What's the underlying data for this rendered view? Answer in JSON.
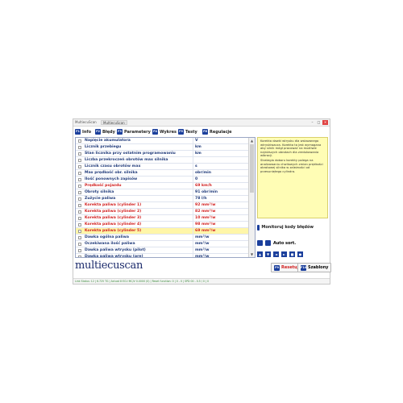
{
  "window": {
    "title": "MultiecuScan",
    "tab_label": "MultiecuScan",
    "min_glyph": "–",
    "max_glyph": "□",
    "close_glyph": "✕"
  },
  "tabs": [
    {
      "key": "F1",
      "label": "Info"
    },
    {
      "key": "F2",
      "label": "Błędy"
    },
    {
      "key": "F3",
      "label": "Parametery"
    },
    {
      "key": "F4",
      "label": "Wykres"
    },
    {
      "key": "F5",
      "label": "Testy"
    },
    {
      "key": "F6",
      "label": "Regulacje"
    }
  ],
  "params": [
    {
      "name": "Napięcie akumulatora",
      "value": "V",
      "style": "blue"
    },
    {
      "name": "Licznik przebiegu",
      "value": "km",
      "style": "blue"
    },
    {
      "name": "Stan licznika przy ostatnim programowaniu",
      "value": "km",
      "style": "blue"
    },
    {
      "name": "Liczba przekroczeń obrotów max silnika",
      "value": "",
      "style": "blue"
    },
    {
      "name": "Licznik czasu obrotów max",
      "value": "s",
      "style": "blue"
    },
    {
      "name": "Max prędkość obr. silnika",
      "value": "obr/min",
      "style": "blue"
    },
    {
      "name": "Ilość ponownych zapisów",
      "value": "0",
      "style": "blue"
    },
    {
      "name": "Prędkość pojazdu",
      "value": "69 km/h",
      "style": "red"
    },
    {
      "name": "Obroty silnika",
      "value": "91 obr/min",
      "style": "blue"
    },
    {
      "name": "Zużycie paliwa",
      "value": "78 l/h",
      "style": "blue"
    },
    {
      "name": "Korekta paliwa (cylinder 1)",
      "value": "92 mm³/w",
      "style": "red"
    },
    {
      "name": "Korekta paliwa (cylinder 2)",
      "value": "82 mm³/w",
      "style": "red"
    },
    {
      "name": "Korekta paliwa (cylinder 3)",
      "value": "10 mm³/w",
      "style": "red"
    },
    {
      "name": "Korekta paliwa (cylinder 4)",
      "value": "98 mm³/w",
      "style": "red"
    },
    {
      "name": "Korekta paliwa (cylinder 5)",
      "value": "69 mm³/w",
      "style": "red hl"
    },
    {
      "name": "Dawka ogólna paliwa",
      "value": "mm³/w",
      "style": "blue"
    },
    {
      "name": "Oczekiwana ilość paliwa",
      "value": "mm³/w",
      "style": "blue"
    },
    {
      "name": "Dawka paliwa wtrysku (pilot)",
      "value": "mm³/w",
      "style": "blue"
    },
    {
      "name": "Dawka paliwa wtrysku (pre)",
      "value": "mm³/w",
      "style": "blue"
    },
    {
      "name": "Dawka paliwa wtrysku (MAIN)",
      "value": "mm³/w",
      "style": "blue"
    }
  ],
  "description": [
    "Korekta dawki wtrysku dla wskazanego wtryskiwacza. Korekta ta jest wymagana aby silnik mógł pracować na możliwie najniższych obrotach dla zredukowania wibracji.",
    "Strategia doboru korekty polega na analizowaniu chwilowych zmian prędkości obrotowej silnika w zależności od przesuniętego cylindra."
  ],
  "buttons": {
    "monitor": "Monitoruj kody błędów",
    "auto_sort": "Auto sort.",
    "reset": "Resetuj",
    "templates": "Szablony",
    "reset_key": "F9",
    "templates_key": "F10"
  },
  "nav_glyphs": [
    "▲",
    "▼",
    "◄",
    "►",
    "■",
    "●"
  ],
  "logo": "multiecuscan",
  "status": "Link Status: 12 | 6.725 TG | Actuat 8 ECU MC/V 0.0000 (0) | Reset function: 0 | 0 - 0 | SPD 00 - 0.5 / 0 | 0",
  "colors": {
    "accent_blue": "#1b3f9c",
    "value_red": "#d22020",
    "highlight_yellow": "#fff6a8",
    "description_bg": "#fffdb5"
  }
}
